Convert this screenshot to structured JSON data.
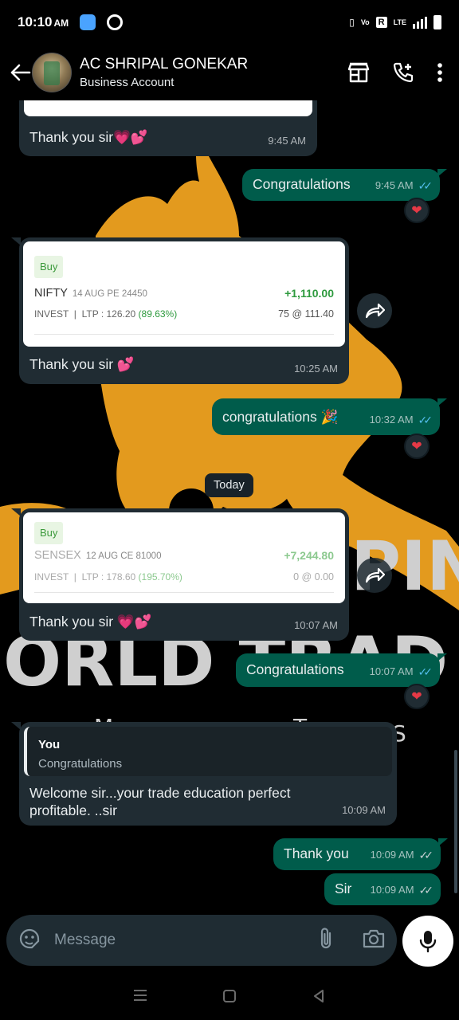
{
  "status_bar": {
    "time": "10:10",
    "ampm": "AM",
    "net": "LTE"
  },
  "header": {
    "name": "AC SHRIPAL GONEKAR",
    "subtitle": "Business Account"
  },
  "wallpaper": {
    "word1": "PING",
    "word2": "ORLD TRAD",
    "word3": "M",
    "word4": "T",
    "word5": "S"
  },
  "messages": {
    "m1": {
      "text": "Thank you sir",
      "emoji": "💗💕",
      "time": "9:45 AM"
    },
    "m2": {
      "text": "Congratulations",
      "time": "9:45 AM",
      "reaction": "❤"
    },
    "m3": {
      "card": {
        "tag": "Buy",
        "symbol": "NIFTY",
        "contract": "14 AUG PE 24450",
        "pnl": "+1,110.00",
        "invest_label": "INVEST",
        "ltp": "LTP : 126.20",
        "pct": "(89.63%)",
        "qty": "75 @ 111.40"
      },
      "text": "Thank you sir",
      "emoji": "💕",
      "time": "10:25 AM"
    },
    "m4": {
      "text": "congratulations",
      "emoji": "🎉",
      "time": "10:32 AM",
      "reaction": "❤"
    },
    "date_chip": "Today",
    "m5": {
      "card": {
        "tag": "Buy",
        "symbol": "SENSEX",
        "contract": "12 AUG CE 81000",
        "pnl": "+7,244.80",
        "invest_label": "INVEST",
        "ltp": "LTP : 178.60",
        "pct": "(195.70%)",
        "qty": "0 @ 0.00"
      },
      "text": "Thank you sir",
      "emoji": "💗💕",
      "time": "10:07 AM"
    },
    "m6": {
      "text": "Congratulations",
      "time": "10:07 AM",
      "reaction": "❤"
    },
    "m7": {
      "quote_author": "You",
      "quote_text": "Congratulations",
      "text": "Welcome sir...your trade education perfect profitable. ..sir",
      "time": "10:09 AM"
    },
    "m8": {
      "text": "Thank you",
      "time": "10:09 AM"
    },
    "m9": {
      "text": "Sir",
      "time": "10:09 AM"
    }
  },
  "input": {
    "placeholder": "Message"
  },
  "colors": {
    "incoming": "#202c33",
    "outgoing": "#005c4b",
    "read_ticks": "#53bdeb",
    "wallpaper_accent": "#e39a1e"
  }
}
